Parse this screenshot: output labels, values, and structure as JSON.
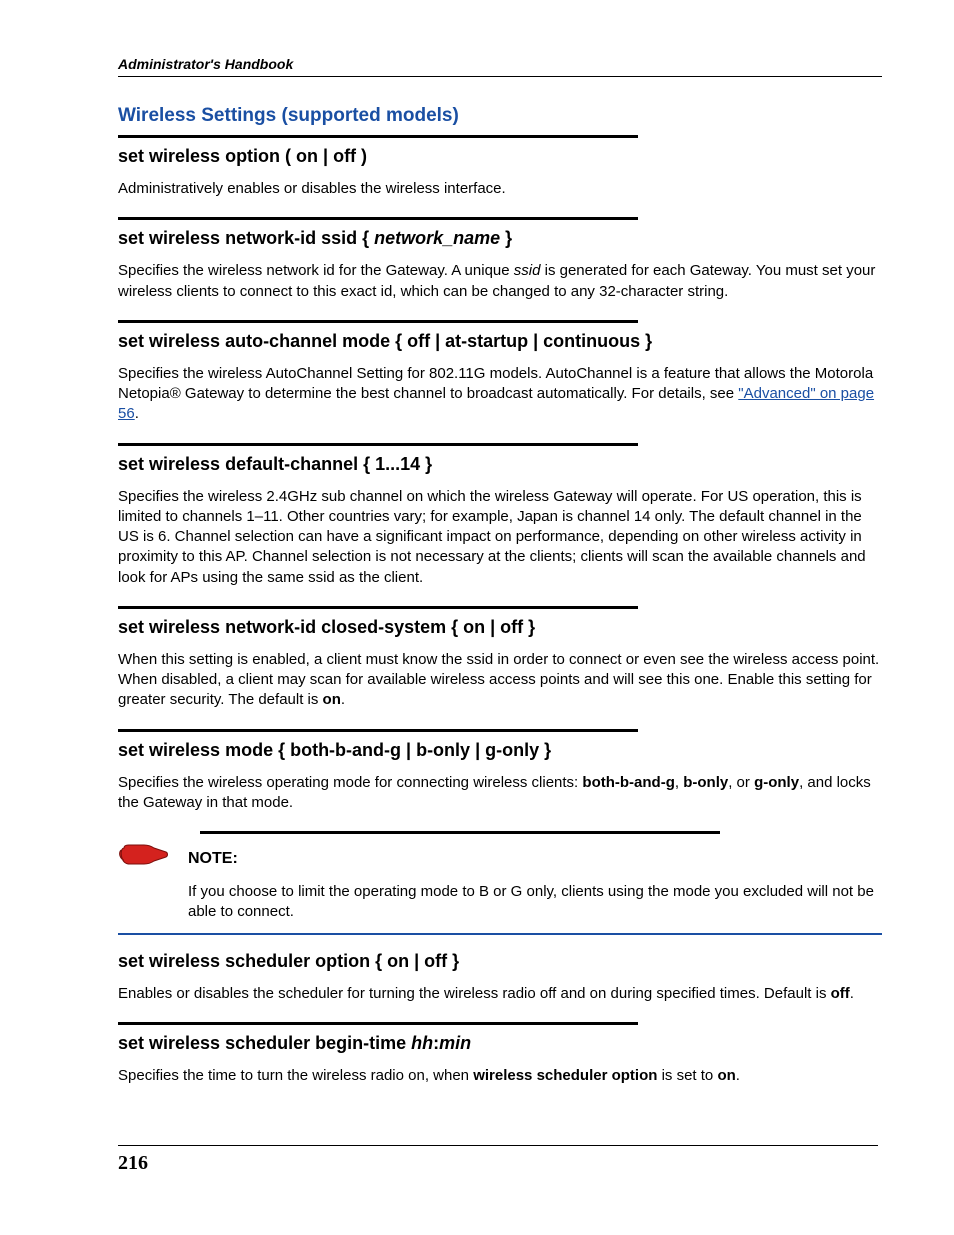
{
  "running_header": "Administrator's Handbook",
  "section_title": "Wireless Settings (supported models)",
  "page_number": "216",
  "link_advanced": "\"Advanced\" on page 56",
  "note_label": "NOTE:",
  "note_text": "If you choose to limit the operating mode to B or G only, clients using the mode you excluded will not be able to connect.",
  "cmd1": {
    "head": "set wireless option ( on | off )",
    "body": "Administratively enables or disables the wireless interface."
  },
  "cmd2": {
    "head_pre": "set wireless network-id ssid { ",
    "head_em": "network_name",
    "head_post": " }",
    "body_pre": "Specifies the wireless network id for the Gateway. A unique ",
    "body_em": "ssid",
    "body_post": " is generated for each Gateway. You must set your wireless clients to connect to this exact id, which can be changed to any 32-character string."
  },
  "cmd3": {
    "head": "set wireless auto-channel mode { off | at-startup | continuous }",
    "body_pre": "Specifies the wireless AutoChannel Setting for 802.11G models. AutoChannel is a feature that allows the Motorola Netopia® Gateway to determine the best channel to broadcast automatically. For details, see "
  },
  "cmd4": {
    "head": "set wireless default-channel { 1...14 }",
    "body": "Specifies the wireless 2.4GHz sub channel on which the wireless Gateway will operate. For US operation, this is limited to channels 1–11. Other countries vary; for example, Japan is channel 14 only. The default channel in the US is 6. Channel selection can have a significant impact on performance, depending on other wireless activity in proximity to this AP. Channel selection is not necessary at the clients; clients will scan the available channels and look for APs using the same ssid as the client."
  },
  "cmd5": {
    "head": "set wireless network-id closed-system { on | off }",
    "body_pre": "When this setting is enabled, a client must know the ssid in order to connect or even see the wireless access point. When disabled, a client may scan for available wireless access points and will see this one. Enable this setting for greater security. The default is ",
    "body_bold": "on",
    "body_post": "."
  },
  "cmd6": {
    "head": "set wireless mode { both-b-and-g | b-only | g-only }",
    "body_pre": "Specifies the wireless operating mode for connecting wireless clients: ",
    "b1": "both-b-and-g",
    "s1": ", ",
    "b2": "b-only",
    "s2": ", or ",
    "b3": "g-only",
    "body_post": ", and locks the Gateway in that mode."
  },
  "cmd7": {
    "head": "set wireless scheduler option { on | off }",
    "body_pre": "Enables or disables the scheduler for turning the wireless radio off and on during specified times. Default is ",
    "body_bold": "off",
    "body_post": "."
  },
  "cmd8": {
    "head_pre": "set wireless scheduler begin-time ",
    "head_em1": "hh",
    "head_mid": ":",
    "head_em2": "min",
    "body_pre": "Specifies the time to turn the wireless radio on, when ",
    "body_bold1": "wireless scheduler option",
    "body_mid": " is set to ",
    "body_bold2": "on",
    "body_post": "."
  }
}
